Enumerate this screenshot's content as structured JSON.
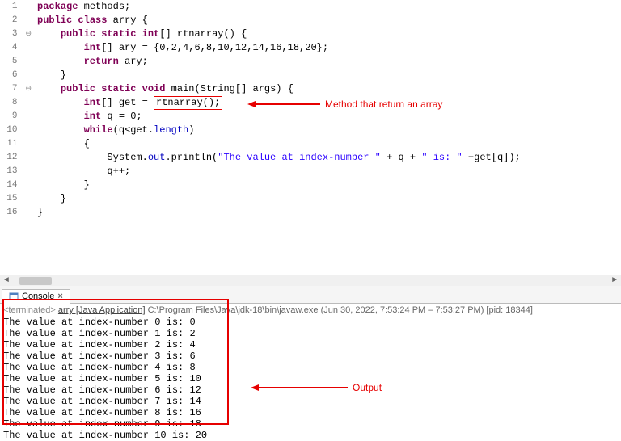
{
  "code": {
    "lines": [
      {
        "num": 1,
        "fold": "",
        "html": "<span class='kw'>package</span> methods;"
      },
      {
        "num": 2,
        "fold": "",
        "html": "<span class='kw'>public</span> <span class='kw'>class</span> arry {"
      },
      {
        "num": 3,
        "fold": "⊖",
        "html": "    <span class='kw'>public</span> <span class='kw'>static</span> <span class='kw'>int</span>[] rtnarray() {"
      },
      {
        "num": 4,
        "fold": "",
        "html": "        <span class='kw'>int</span>[] ary = {0,2,4,6,8,10,12,14,16,18,20};"
      },
      {
        "num": 5,
        "fold": "",
        "html": "        <span class='kw'>return</span> ary;"
      },
      {
        "num": 6,
        "fold": "",
        "html": "    }"
      },
      {
        "num": 7,
        "fold": "⊖",
        "html": "    <span class='kw'>public</span> <span class='kw'>static</span> <span class='kw'>void</span> main(String[] args) {"
      },
      {
        "num": 8,
        "fold": "",
        "html": "        <span class='kw'>int</span>[] get = <span class='callout-box'><span class='plain'>rtnarray();</span></span>"
      },
      {
        "num": 9,
        "fold": "",
        "html": "        <span class='kw'>int</span> q = 0;"
      },
      {
        "num": 10,
        "fold": "",
        "html": "        <span class='kw'>while</span>(q&lt;get.<span class='field'>length</span>)"
      },
      {
        "num": 11,
        "fold": "",
        "html": "        {"
      },
      {
        "num": 12,
        "fold": "",
        "html": "            System.<span class='field'>out</span>.println(<span class='str'>\"The value at index-number \"</span> + q + <span class='str'>\" is: \"</span> +get[q]);"
      },
      {
        "num": 13,
        "fold": "",
        "html": "            q++;"
      },
      {
        "num": 14,
        "fold": "",
        "html": "        }"
      },
      {
        "num": 15,
        "fold": "",
        "html": "    }"
      },
      {
        "num": 16,
        "fold": "",
        "html": "}"
      }
    ]
  },
  "callouts": {
    "method_label": "Method that return an array",
    "output_label": "Output"
  },
  "console": {
    "tab_label": "Console",
    "status_prefix": "<terminated>",
    "status_app": "arry [Java Application]",
    "status_path": "C:\\Program Files\\Java\\jdk-18\\bin\\javaw.exe",
    "status_time": "(Jun 30, 2022, 7:53:24 PM – 7:53:27 PM) [pid: 18344]",
    "output_lines": [
      "The value at index-number 0 is: 0",
      "The value at index-number 1 is: 2",
      "The value at index-number 2 is: 4",
      "The value at index-number 3 is: 6",
      "The value at index-number 4 is: 8",
      "The value at index-number 5 is: 10",
      "The value at index-number 6 is: 12",
      "The value at index-number 7 is: 14",
      "The value at index-number 8 is: 16",
      "The value at index-number 9 is: 18",
      "The value at index-number 10 is: 20"
    ]
  },
  "colors": {
    "accent_red": "#e60000",
    "keyword": "#7f0055",
    "string_lit": "#2a00ff",
    "field_ref": "#0000c0"
  }
}
